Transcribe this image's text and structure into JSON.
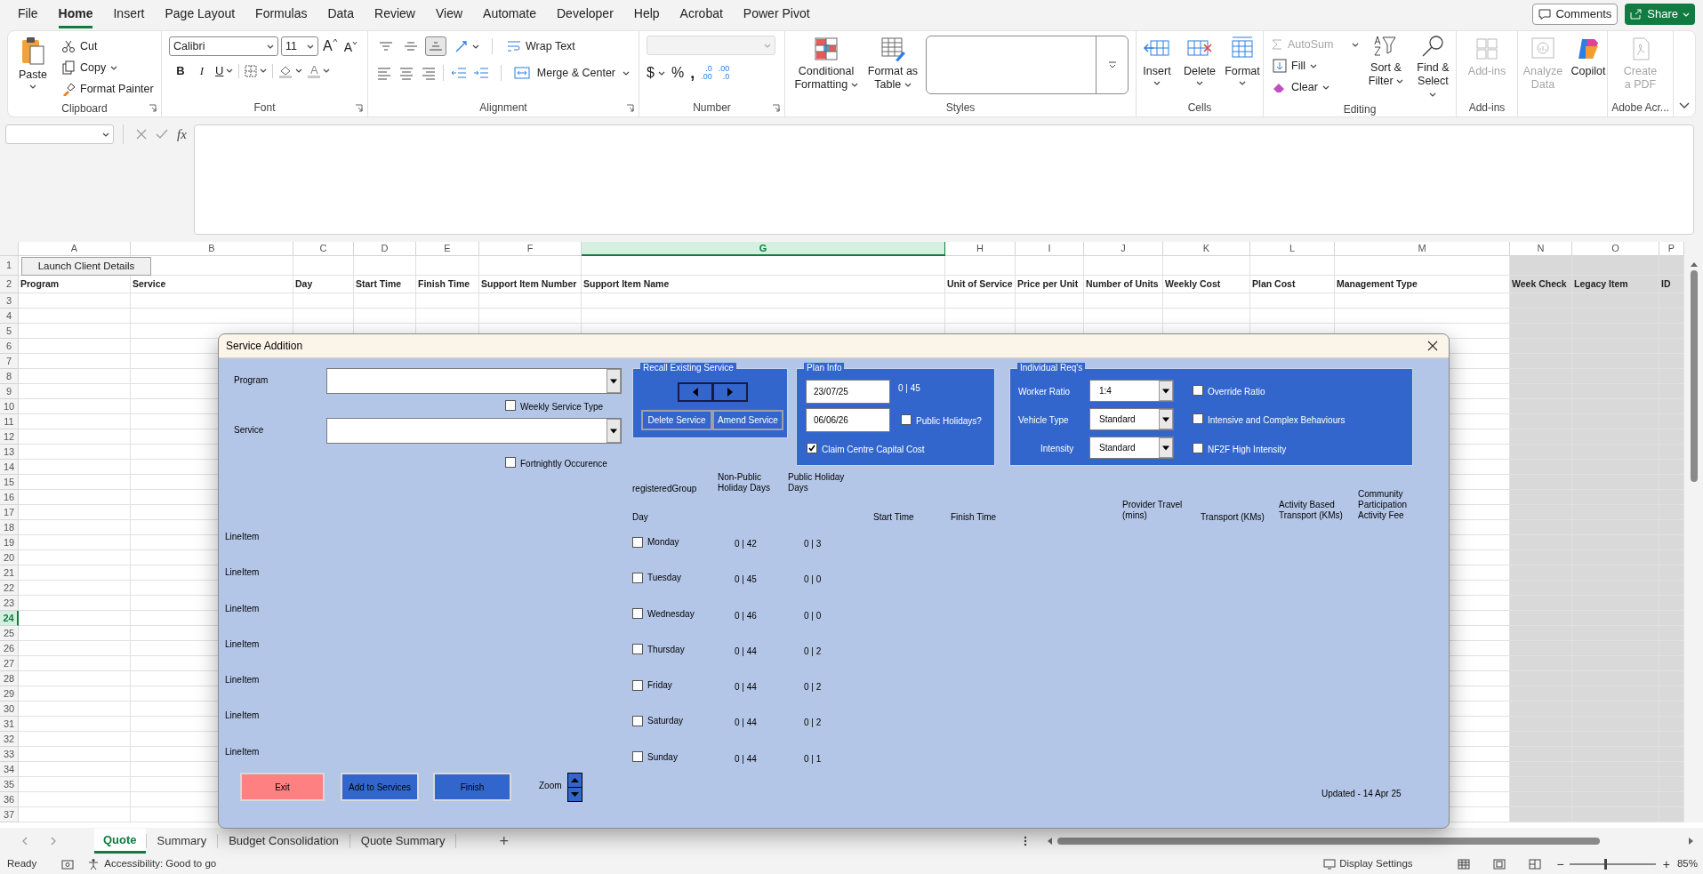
{
  "menu_tabs": [
    {
      "label": "File",
      "selected": false
    },
    {
      "label": "Home",
      "selected": true
    },
    {
      "label": "Insert",
      "selected": false
    },
    {
      "label": "Page Layout",
      "selected": false
    },
    {
      "label": "Formulas",
      "selected": false
    },
    {
      "label": "Data",
      "selected": false
    },
    {
      "label": "Review",
      "selected": false
    },
    {
      "label": "View",
      "selected": false
    },
    {
      "label": "Automate",
      "selected": false
    },
    {
      "label": "Developer",
      "selected": false
    },
    {
      "label": "Help",
      "selected": false
    },
    {
      "label": "Acrobat",
      "selected": false
    },
    {
      "label": "Power Pivot",
      "selected": false
    }
  ],
  "comments": "Comments",
  "share": "Share",
  "ribbon": {
    "clipboard": {
      "label": "Clipboard",
      "paste": "Paste",
      "cut": "Cut",
      "copy": "Copy",
      "format_painter": "Format Painter"
    },
    "font": {
      "label": "Font",
      "font_name": "Calibri",
      "font_size": "11",
      "grow": "A",
      "shrink": "A",
      "bold": "B",
      "italic": "I",
      "underline": "U",
      "font_color": "A"
    },
    "alignment": {
      "label": "Alignment",
      "vertical_align": [
        {
          "selected": false
        },
        {
          "selected": false
        },
        {
          "selected": true
        }
      ],
      "wrap_text": "Wrap Text",
      "merge": "Merge & Center"
    },
    "number": {
      "label": "Number",
      "currency": "$",
      "percent": "%",
      "comma": ",",
      "increase_decimal": [
        ".0",
        ".00"
      ],
      "decrease_decimal": [
        ".00",
        ".0"
      ]
    },
    "styles": {
      "label": "Styles",
      "conditional": "Conditional Formatting",
      "format_table": "Format as Table"
    },
    "cells": {
      "label": "Cells",
      "buttons": [
        "Insert",
        "Delete",
        "Format"
      ]
    },
    "editing": {
      "label": "Editing",
      "autosum": {
        "label": "AutoSum",
        "disabled": true
      },
      "fill": "Fill",
      "clear": "Clear",
      "sort": "Sort & Filter",
      "find": "Find & Select"
    },
    "addins": {
      "label": "Add-ins",
      "button": {
        "label": "Add-ins",
        "disabled": true
      }
    },
    "ai": {
      "analyze": {
        "label": "Analyze Data",
        "disabled": true
      },
      "copilot": "Copilot"
    },
    "adobe": {
      "label": "Adobe Acr...",
      "create_pdf": {
        "label": "Create a PDF",
        "disabled": true
      }
    }
  },
  "formula_bar": {
    "fx": "fx"
  },
  "sheet": {
    "launch_button": "Launch Client Details",
    "columns": [
      {
        "letter": "A",
        "header": "Program",
        "selected": false,
        "shaded": false
      },
      {
        "letter": "B",
        "header": "Service",
        "selected": false,
        "shaded": false
      },
      {
        "letter": "C",
        "header": "Day",
        "selected": false,
        "shaded": false
      },
      {
        "letter": "D",
        "header": "Start Time",
        "selected": false,
        "shaded": false
      },
      {
        "letter": "E",
        "header": "Finish Time",
        "selected": false,
        "shaded": false
      },
      {
        "letter": "F",
        "header": "Support Item Number",
        "selected": false,
        "shaded": false
      },
      {
        "letter": "G",
        "header": "Support Item Name",
        "selected": true,
        "shaded": false
      },
      {
        "letter": "H",
        "header": "Unit of Service",
        "selected": false,
        "shaded": false
      },
      {
        "letter": "I",
        "header": "Price per Unit",
        "selected": false,
        "shaded": false
      },
      {
        "letter": "J",
        "header": "Number of Units",
        "selected": false,
        "shaded": false
      },
      {
        "letter": "K",
        "header": "Weekly Cost",
        "selected": false,
        "shaded": false
      },
      {
        "letter": "L",
        "header": "Plan Cost",
        "selected": false,
        "shaded": false
      },
      {
        "letter": "M",
        "header": "Management Type",
        "selected": false,
        "shaded": false
      },
      {
        "letter": "N",
        "header": "Week Check",
        "selected": false,
        "shaded": true
      },
      {
        "letter": "O",
        "header": "Legacy Item",
        "selected": false,
        "shaded": true
      },
      {
        "letter": "P",
        "header": "ID",
        "selected": false,
        "shaded": true
      }
    ],
    "rows": [
      {
        "number": "1",
        "selected": false
      },
      {
        "number": "2",
        "selected": false
      },
      {
        "number": "3",
        "selected": false
      },
      {
        "number": "4",
        "selected": false
      },
      {
        "number": "5",
        "selected": false
      },
      {
        "number": "6",
        "selected": false
      },
      {
        "number": "7",
        "selected": false
      },
      {
        "number": "8",
        "selected": false
      },
      {
        "number": "9",
        "selected": false
      },
      {
        "number": "10",
        "selected": false
      },
      {
        "number": "11",
        "selected": false
      },
      {
        "number": "12",
        "selected": false
      },
      {
        "number": "13",
        "selected": false
      },
      {
        "number": "14",
        "selected": false
      },
      {
        "number": "15",
        "selected": false
      },
      {
        "number": "16",
        "selected": false
      },
      {
        "number": "17",
        "selected": false
      },
      {
        "number": "18",
        "selected": false
      },
      {
        "number": "19",
        "selected": false
      },
      {
        "number": "20",
        "selected": false
      },
      {
        "number": "21",
        "selected": false
      },
      {
        "number": "22",
        "selected": false
      },
      {
        "number": "23",
        "selected": false
      },
      {
        "number": "24",
        "selected": true
      },
      {
        "number": "25",
        "selected": false
      },
      {
        "number": "26",
        "selected": false
      },
      {
        "number": "27",
        "selected": false
      },
      {
        "number": "28",
        "selected": false
      },
      {
        "number": "29",
        "selected": false
      },
      {
        "number": "30",
        "selected": false
      },
      {
        "number": "31",
        "selected": false
      },
      {
        "number": "32",
        "selected": false
      },
      {
        "number": "33",
        "selected": false
      },
      {
        "number": "34",
        "selected": false
      },
      {
        "number": "35",
        "selected": false
      },
      {
        "number": "36",
        "selected": false
      },
      {
        "number": "37",
        "selected": false
      }
    ]
  },
  "dialog": {
    "title": "Service Addition",
    "program": {
      "label": "Program"
    },
    "service": {
      "label": "Service"
    },
    "weekly_service_type": {
      "label": "Weekly Service Type",
      "checked": false
    },
    "fortnightly_occurrence": {
      "label": "Fortnightly Occurence",
      "checked": false
    },
    "recall": {
      "title": "Recall Existing Service",
      "delete": "Delete Service",
      "amend": "Amend Service"
    },
    "plan_info": {
      "title": "Plan Info",
      "start_date": "23/07/25",
      "end_date": "06/06/26",
      "days": "0 | 45",
      "public_holidays": {
        "label": "Public Holidays?",
        "checked": false
      },
      "claim_centre": {
        "label": "Claim Centre Capital Cost",
        "checked": true
      }
    },
    "individual": {
      "title": "Individual Req's",
      "fields": [
        {
          "label": "Worker Ratio",
          "value": "1:4"
        },
        {
          "label": "Vehicle Type",
          "value": "Standard"
        },
        {
          "label": "Intensity",
          "value": "Standard"
        }
      ],
      "options": [
        {
          "label": "Override Ratio",
          "checked": false
        },
        {
          "label": "Intensive and Complex Behaviours",
          "checked": false
        },
        {
          "label": "NF2F High Intensity",
          "checked": false
        }
      ]
    },
    "registered_group": "registeredGroup",
    "columns": {
      "day": "Day",
      "non_public": "Non-Public Holiday Days",
      "public": "Public Holiday Days",
      "start": "Start Time",
      "finish": "Finish Time",
      "provider_travel": "Provider Travel (mins)",
      "transport": "Transport (KMs)",
      "activity_transport": "Activity Based Transport (KMs)",
      "community": "Community Participation Activity Fee"
    },
    "days": [
      {
        "line_item": "LineItem",
        "day": "Monday",
        "checked": false,
        "non_public": "0 | 42",
        "public": "0 | 3"
      },
      {
        "line_item": "LineItem",
        "day": "Tuesday",
        "checked": false,
        "non_public": "0 | 45",
        "public": "0 | 0"
      },
      {
        "line_item": "LineItem",
        "day": "Wednesday",
        "checked": false,
        "non_public": "0 | 46",
        "public": "0 | 0"
      },
      {
        "line_item": "LineItem",
        "day": "Thursday",
        "checked": false,
        "non_public": "0 | 44",
        "public": "0 | 2"
      },
      {
        "line_item": "LineItem",
        "day": "Friday",
        "checked": false,
        "non_public": "0 | 44",
        "public": "0 | 2"
      },
      {
        "line_item": "LineItem",
        "day": "Saturday",
        "checked": false,
        "non_public": "0 | 44",
        "public": "0 | 2"
      },
      {
        "line_item": "LineItem",
        "day": "Sunday",
        "checked": false,
        "non_public": "0 | 44",
        "public": "0 | 1"
      }
    ],
    "buttons": {
      "exit": "Exit",
      "add": "Add to Services",
      "finish": "Finish"
    },
    "zoom": "Zoom",
    "updated": "Updated - 14 Apr 25"
  },
  "sheet_tabs": [
    {
      "label": "Quote",
      "selected": true
    },
    {
      "label": "Summary",
      "selected": false
    },
    {
      "label": "Budget Consolidation",
      "selected": false
    },
    {
      "label": "Quote Summary",
      "selected": false
    }
  ],
  "add_sheet": "+",
  "status_bar": {
    "ready": "Ready",
    "accessibility": "Accessibility: Good to go",
    "display_settings": "Display Settings",
    "zoom_minus": "−",
    "zoom_plus": "+",
    "zoom": "85%",
    "zoom_slider": {
      "level": 0.41
    }
  }
}
